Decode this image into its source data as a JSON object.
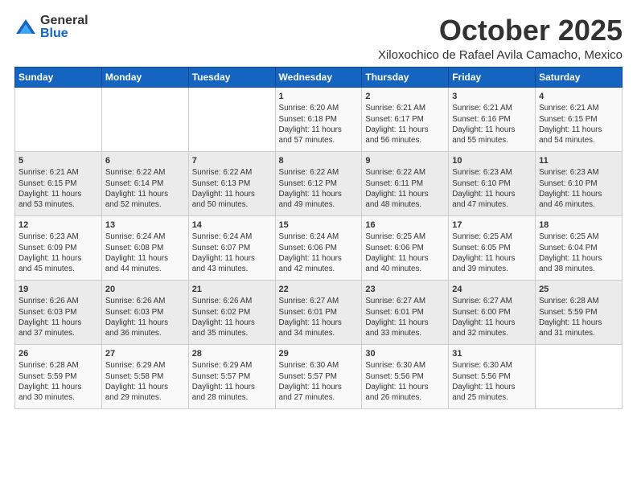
{
  "logo": {
    "general": "General",
    "blue": "Blue"
  },
  "title": "October 2025",
  "location": "Xiloxochico de Rafael Avila Camacho, Mexico",
  "weekdays": [
    "Sunday",
    "Monday",
    "Tuesday",
    "Wednesday",
    "Thursday",
    "Friday",
    "Saturday"
  ],
  "weeks": [
    [
      {
        "day": "",
        "info": ""
      },
      {
        "day": "",
        "info": ""
      },
      {
        "day": "",
        "info": ""
      },
      {
        "day": "1",
        "info": "Sunrise: 6:20 AM\nSunset: 6:18 PM\nDaylight: 11 hours\nand 57 minutes."
      },
      {
        "day": "2",
        "info": "Sunrise: 6:21 AM\nSunset: 6:17 PM\nDaylight: 11 hours\nand 56 minutes."
      },
      {
        "day": "3",
        "info": "Sunrise: 6:21 AM\nSunset: 6:16 PM\nDaylight: 11 hours\nand 55 minutes."
      },
      {
        "day": "4",
        "info": "Sunrise: 6:21 AM\nSunset: 6:15 PM\nDaylight: 11 hours\nand 54 minutes."
      }
    ],
    [
      {
        "day": "5",
        "info": "Sunrise: 6:21 AM\nSunset: 6:15 PM\nDaylight: 11 hours\nand 53 minutes."
      },
      {
        "day": "6",
        "info": "Sunrise: 6:22 AM\nSunset: 6:14 PM\nDaylight: 11 hours\nand 52 minutes."
      },
      {
        "day": "7",
        "info": "Sunrise: 6:22 AM\nSunset: 6:13 PM\nDaylight: 11 hours\nand 50 minutes."
      },
      {
        "day": "8",
        "info": "Sunrise: 6:22 AM\nSunset: 6:12 PM\nDaylight: 11 hours\nand 49 minutes."
      },
      {
        "day": "9",
        "info": "Sunrise: 6:22 AM\nSunset: 6:11 PM\nDaylight: 11 hours\nand 48 minutes."
      },
      {
        "day": "10",
        "info": "Sunrise: 6:23 AM\nSunset: 6:10 PM\nDaylight: 11 hours\nand 47 minutes."
      },
      {
        "day": "11",
        "info": "Sunrise: 6:23 AM\nSunset: 6:10 PM\nDaylight: 11 hours\nand 46 minutes."
      }
    ],
    [
      {
        "day": "12",
        "info": "Sunrise: 6:23 AM\nSunset: 6:09 PM\nDaylight: 11 hours\nand 45 minutes."
      },
      {
        "day": "13",
        "info": "Sunrise: 6:24 AM\nSunset: 6:08 PM\nDaylight: 11 hours\nand 44 minutes."
      },
      {
        "day": "14",
        "info": "Sunrise: 6:24 AM\nSunset: 6:07 PM\nDaylight: 11 hours\nand 43 minutes."
      },
      {
        "day": "15",
        "info": "Sunrise: 6:24 AM\nSunset: 6:06 PM\nDaylight: 11 hours\nand 42 minutes."
      },
      {
        "day": "16",
        "info": "Sunrise: 6:25 AM\nSunset: 6:06 PM\nDaylight: 11 hours\nand 40 minutes."
      },
      {
        "day": "17",
        "info": "Sunrise: 6:25 AM\nSunset: 6:05 PM\nDaylight: 11 hours\nand 39 minutes."
      },
      {
        "day": "18",
        "info": "Sunrise: 6:25 AM\nSunset: 6:04 PM\nDaylight: 11 hours\nand 38 minutes."
      }
    ],
    [
      {
        "day": "19",
        "info": "Sunrise: 6:26 AM\nSunset: 6:03 PM\nDaylight: 11 hours\nand 37 minutes."
      },
      {
        "day": "20",
        "info": "Sunrise: 6:26 AM\nSunset: 6:03 PM\nDaylight: 11 hours\nand 36 minutes."
      },
      {
        "day": "21",
        "info": "Sunrise: 6:26 AM\nSunset: 6:02 PM\nDaylight: 11 hours\nand 35 minutes."
      },
      {
        "day": "22",
        "info": "Sunrise: 6:27 AM\nSunset: 6:01 PM\nDaylight: 11 hours\nand 34 minutes."
      },
      {
        "day": "23",
        "info": "Sunrise: 6:27 AM\nSunset: 6:01 PM\nDaylight: 11 hours\nand 33 minutes."
      },
      {
        "day": "24",
        "info": "Sunrise: 6:27 AM\nSunset: 6:00 PM\nDaylight: 11 hours\nand 32 minutes."
      },
      {
        "day": "25",
        "info": "Sunrise: 6:28 AM\nSunset: 5:59 PM\nDaylight: 11 hours\nand 31 minutes."
      }
    ],
    [
      {
        "day": "26",
        "info": "Sunrise: 6:28 AM\nSunset: 5:59 PM\nDaylight: 11 hours\nand 30 minutes."
      },
      {
        "day": "27",
        "info": "Sunrise: 6:29 AM\nSunset: 5:58 PM\nDaylight: 11 hours\nand 29 minutes."
      },
      {
        "day": "28",
        "info": "Sunrise: 6:29 AM\nSunset: 5:57 PM\nDaylight: 11 hours\nand 28 minutes."
      },
      {
        "day": "29",
        "info": "Sunrise: 6:30 AM\nSunset: 5:57 PM\nDaylight: 11 hours\nand 27 minutes."
      },
      {
        "day": "30",
        "info": "Sunrise: 6:30 AM\nSunset: 5:56 PM\nDaylight: 11 hours\nand 26 minutes."
      },
      {
        "day": "31",
        "info": "Sunrise: 6:30 AM\nSunset: 5:56 PM\nDaylight: 11 hours\nand 25 minutes."
      },
      {
        "day": "",
        "info": ""
      }
    ]
  ]
}
